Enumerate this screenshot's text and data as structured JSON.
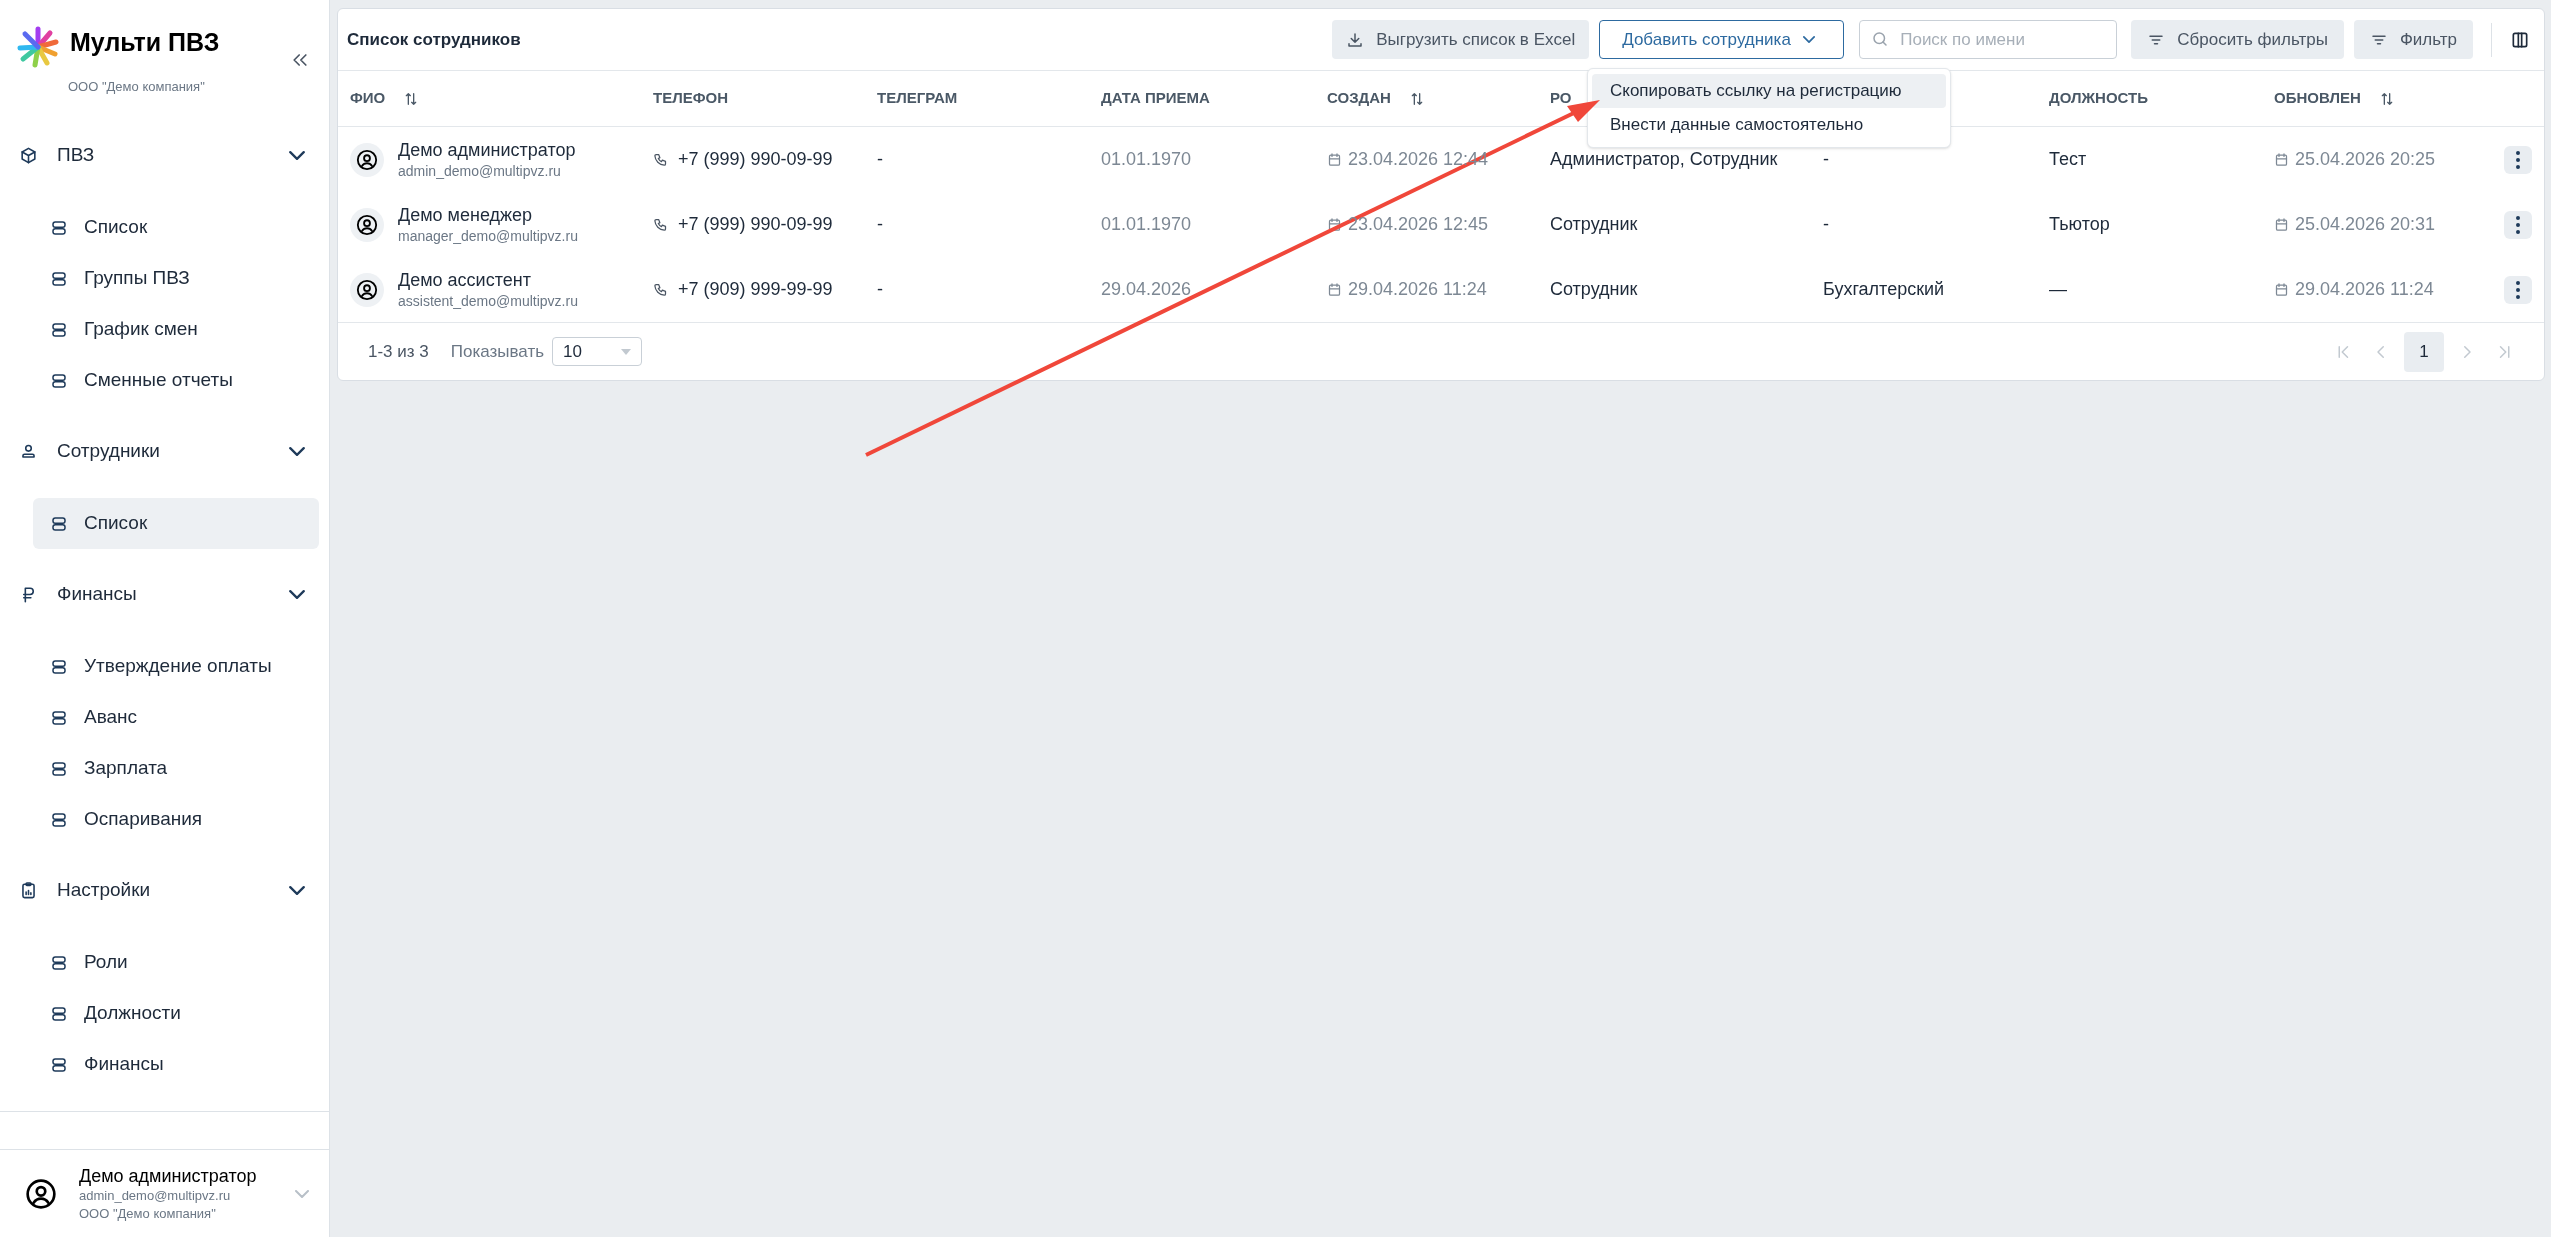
{
  "sidebar": {
    "brand": {
      "title": "Мульти ПВЗ",
      "subtitle": "ООО \"Демо компания\""
    },
    "nav": [
      {
        "label": "ПВЗ",
        "expanded": true,
        "children": [
          {
            "label": "Список",
            "selected": false
          },
          {
            "label": "Группы ПВЗ",
            "selected": false
          },
          {
            "label": "График смен",
            "selected": false
          },
          {
            "label": "Сменные отчеты",
            "selected": false
          }
        ]
      },
      {
        "label": "Сотрудники",
        "expanded": true,
        "children": [
          {
            "label": "Список",
            "selected": true
          }
        ]
      },
      {
        "label": "Финансы",
        "expanded": true,
        "children": [
          {
            "label": "Утверждение оплаты",
            "selected": false
          },
          {
            "label": "Аванс",
            "selected": false
          },
          {
            "label": "Зарплата",
            "selected": false
          },
          {
            "label": "Оспаривания",
            "selected": false
          }
        ]
      },
      {
        "label": "Настройки",
        "expanded": true,
        "children": [
          {
            "label": "Роли",
            "selected": false
          },
          {
            "label": "Должности",
            "selected": false
          },
          {
            "label": "Финансы",
            "selected": false
          }
        ]
      }
    ],
    "user": {
      "name": "Демо администратор",
      "email": "admin_demo@multipvz.ru",
      "company": "ООО \"Демо компания\""
    }
  },
  "page": {
    "title": "Список сотрудников",
    "toolbar": {
      "export_label": "Выгрузить список в Excel",
      "add_label": "Добавить сотрудника",
      "search_placeholder": "Поиск по имени",
      "reset_label": "Сбросить фильтры",
      "filter_label": "Фильтр"
    },
    "dropdown": {
      "open": true,
      "items": [
        {
          "label": "Скопировать ссылку на регистрацию",
          "highlighted": true
        },
        {
          "label": "Внести данные самостоятельно",
          "highlighted": false
        }
      ]
    },
    "table": {
      "columns": [
        {
          "label": "ФИО",
          "kind": "sortable"
        },
        {
          "label": "ТЕЛЕФОН",
          "kind": "plain"
        },
        {
          "label": "ТЕЛЕГРАМ",
          "kind": "plain"
        },
        {
          "label": "ДАТА ПРИЕМА",
          "kind": "plain"
        },
        {
          "label": "СОЗДАН",
          "kind": "sortable"
        },
        {
          "label": "РО",
          "kind": "plain"
        },
        {
          "kind": "plain"
        },
        {
          "label": "ДОЛЖНОСТЬ",
          "kind": "plain"
        },
        {
          "label": "ОБНОВЛЕН",
          "kind": "sortable"
        }
      ],
      "rows": [
        {
          "name": "Демо администратор",
          "email": "admin_demo@multipvz.ru",
          "phone": "+7 (999) 990-09-99",
          "telegram": "-",
          "hire_date": "01.01.1970",
          "created": "23.04.2026 12:44",
          "roles": "Администратор, Сотрудник",
          "column_7": "-",
          "position": "Тест",
          "updated": "25.04.2026 20:25"
        },
        {
          "name": "Демо менеджер",
          "email": "manager_demo@multipvz.ru",
          "phone": "+7 (999) 990-09-99",
          "telegram": "-",
          "hire_date": "01.01.1970",
          "created": "23.04.2026 12:45",
          "roles": "Сотрудник",
          "column_7": "-",
          "position": "Тьютор",
          "updated": "25.04.2026 20:31"
        },
        {
          "name": "Демо ассистент",
          "email": "assistent_demo@multipvz.ru",
          "phone": "+7 (909) 999-99-99",
          "telegram": "-",
          "hire_date": "29.04.2026",
          "created": "29.04.2026 11:24",
          "roles": "Сотрудник",
          "column_7": "Бухгалтерский",
          "position": "—",
          "updated": "29.04.2026 11:24"
        }
      ]
    },
    "pagination": {
      "range": "1-3 из 3",
      "page_size_label": "Показывать",
      "page_size": "10",
      "nav": [
        {
          "kind": "first",
          "disabled": true
        },
        {
          "kind": "prev",
          "disabled": true
        },
        {
          "kind": "page",
          "label": "1",
          "selected": true
        },
        {
          "kind": "next",
          "disabled": true
        },
        {
          "kind": "last",
          "disabled": true
        }
      ]
    }
  }
}
